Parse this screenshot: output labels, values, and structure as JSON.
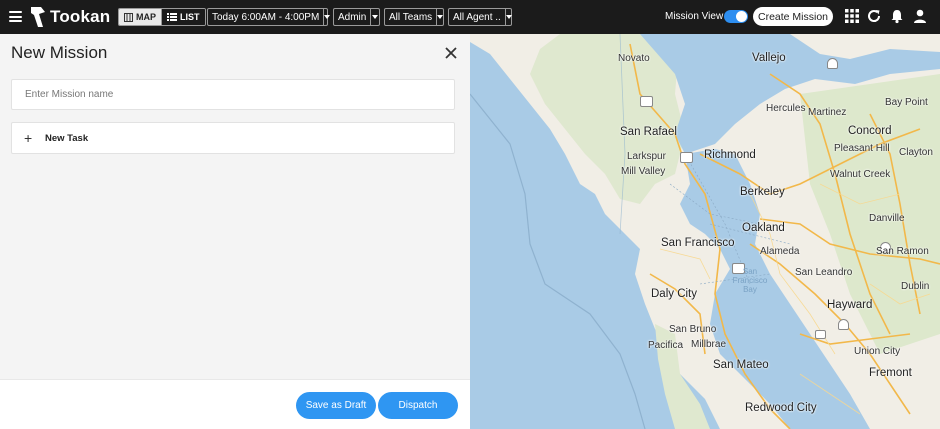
{
  "app": {
    "name": "Tookan"
  },
  "topbar": {
    "map_label": "MAP",
    "list_label": "LIST",
    "date_range": "Today 6:00AM - 4:00PM",
    "user_filter": "Admin",
    "team_filter": "All Teams",
    "agent_filter": "All Agent ..",
    "mission_view_label": "Mission View",
    "mission_view_on": true,
    "create_mission_label": "Create Mission"
  },
  "panel": {
    "title": "New Mission",
    "mission_name_placeholder": "Enter Mission name",
    "new_task_label": "New Task",
    "save_draft_label": "Save as Draft",
    "dispatch_label": "Dispatch"
  },
  "map": {
    "labels": {
      "novato": "Novato",
      "vallejo": "Vallejo",
      "hercules": "Hercules",
      "martinez": "Martinez",
      "bay_point": "Bay Point",
      "san_rafael": "San Rafael",
      "concord": "Concord",
      "pleasant_hill": "Pleasant Hill",
      "larkspur": "Larkspur",
      "richmond": "Richmond",
      "clayton": "Clayton",
      "mill_valley": "Mill Valley",
      "walnut_creek": "Walnut Creek",
      "berkeley": "Berkeley",
      "danville": "Danville",
      "oakland": "Oakland",
      "san_ramon": "San Ramon",
      "san_francisco": "San Francisco",
      "alameda": "Alameda",
      "sf_bay": "San Francisco Bay",
      "daly_city": "Daly City",
      "san_leandro": "San Leandro",
      "dublin": "Dublin",
      "hayward": "Hayward",
      "san_bruno": "San Bruno",
      "pacifica": "Pacifica",
      "millbrae": "Millbrae",
      "union_city": "Union City",
      "san_mateo": "San Mateo",
      "fremont": "Fremont",
      "redwood_city": "Redwood City"
    },
    "highway_shields": [
      "101",
      "580",
      "80",
      "680",
      "92",
      "880"
    ]
  }
}
